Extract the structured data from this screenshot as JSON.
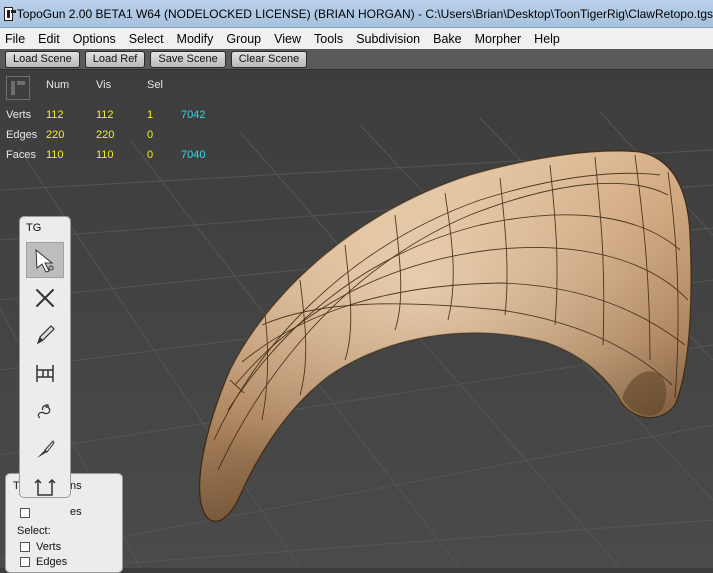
{
  "window": {
    "title": "TopoGun 2.00 BETA1 W64  (NODELOCKED LICENSE) (BRIAN HORGAN) - C:\\Users\\Brian\\Desktop\\ToonTigerRig\\ClawRetopo.tgs"
  },
  "menu": [
    "File",
    "Edit",
    "Options",
    "Select",
    "Modify",
    "Group",
    "View",
    "Tools",
    "Subdivision",
    "Bake",
    "Morpher",
    "Help"
  ],
  "toolbar": {
    "load_scene": "Load Scene",
    "load_ref": "Load Ref",
    "save_scene": "Save Scene",
    "clear_scene": "Clear Scene"
  },
  "stats": {
    "headers": {
      "num": "Num",
      "vis": "Vis",
      "sel": "Sel"
    },
    "rows": [
      {
        "label": "Verts",
        "num": "112",
        "vis": "112",
        "sel": "1",
        "ref": "7042"
      },
      {
        "label": "Edges",
        "num": "220",
        "vis": "220",
        "sel": "0",
        "ref": ""
      },
      {
        "label": "Faces",
        "num": "110",
        "vis": "110",
        "sel": "0",
        "ref": "7040"
      }
    ],
    "colors": {
      "values": "#f2f224",
      "ref": "#33d8e6"
    }
  },
  "tool_panel": {
    "title": "TG",
    "tools": [
      {
        "icon": "select-arrow-icon",
        "active": true
      },
      {
        "icon": "delete-x-icon",
        "active": false
      },
      {
        "icon": "draw-pencil-icon",
        "active": false
      },
      {
        "icon": "bridge-icon",
        "active": false
      },
      {
        "icon": "brush-icon",
        "active": false
      },
      {
        "icon": "knife-icon",
        "active": false
      },
      {
        "icon": "tubes-icon",
        "active": false
      }
    ]
  },
  "options_panel": {
    "title_left": "T",
    "title_right": "ns",
    "row_fragment": "es",
    "select_label": "Select:",
    "verts_label": "Verts",
    "edges_label": "Edges"
  }
}
